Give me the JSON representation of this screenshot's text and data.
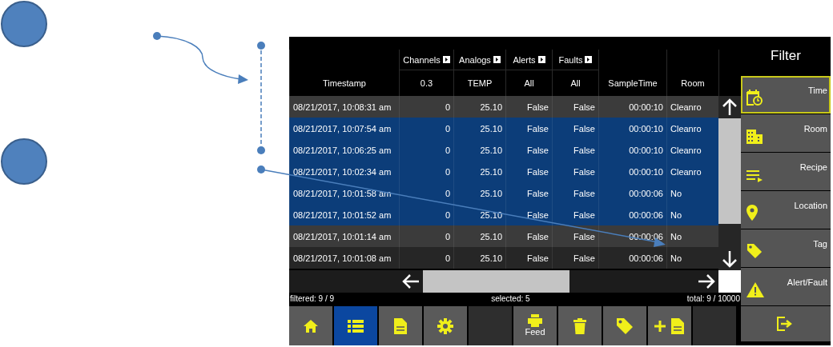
{
  "table": {
    "columns": [
      {
        "label": "Timestamp"
      },
      {
        "label": "Channels",
        "filter": "0.3"
      },
      {
        "label": "Analogs",
        "filter": "TEMP"
      },
      {
        "label": "Alerts",
        "filter": "All"
      },
      {
        "label": "Faults",
        "filter": "All"
      },
      {
        "label": "SampleTime"
      },
      {
        "label": "Room"
      }
    ],
    "rows": [
      {
        "selected": false,
        "cells": [
          "08/21/2017, 10:08:31 am",
          "0",
          "25.10",
          "False",
          "False",
          "00:00:10",
          "Cleanro"
        ]
      },
      {
        "selected": true,
        "cells": [
          "08/21/2017, 10:07:54 am",
          "0",
          "25.10",
          "False",
          "False",
          "00:00:10",
          "Cleanro"
        ]
      },
      {
        "selected": true,
        "cells": [
          "08/21/2017, 10:06:25 am",
          "0",
          "25.10",
          "False",
          "False",
          "00:00:10",
          "Cleanro"
        ]
      },
      {
        "selected": true,
        "cells": [
          "08/21/2017, 10:02:34 am",
          "0",
          "25.10",
          "False",
          "False",
          "00:00:10",
          "Cleanro"
        ]
      },
      {
        "selected": true,
        "cells": [
          "08/21/2017, 10:01:58 am",
          "0",
          "25.10",
          "False",
          "False",
          "00:00:06",
          "No"
        ]
      },
      {
        "selected": true,
        "cells": [
          "08/21/2017, 10:01:52 am",
          "0",
          "25.10",
          "False",
          "False",
          "00:00:06",
          "No"
        ]
      },
      {
        "selected": false,
        "cells": [
          "08/21/2017, 10:01:14 am",
          "0",
          "25.10",
          "False",
          "False",
          "00:00:06",
          "No"
        ]
      },
      {
        "selected": false,
        "cells": [
          "08/21/2017, 10:01:08 am",
          "0",
          "25.10",
          "False",
          "False",
          "00:00:06",
          "No"
        ]
      }
    ]
  },
  "status_bar": {
    "filtered": "filtered: 9 / 9",
    "selected": "selected: 5",
    "total": "total: 9 / 10000"
  },
  "toolbar": [
    {
      "kind": "home",
      "selected": false
    },
    {
      "kind": "list",
      "selected": true
    },
    {
      "kind": "document",
      "selected": false
    },
    {
      "kind": "settings",
      "selected": false
    },
    {
      "kind": "blank",
      "selected": false
    },
    {
      "kind": "print",
      "label": "Feed",
      "selected": false
    },
    {
      "kind": "delete",
      "selected": false
    },
    {
      "kind": "tag",
      "selected": false
    },
    {
      "kind": "add-document",
      "selected": false
    },
    {
      "kind": "blank",
      "selected": false
    }
  ],
  "filter": {
    "title": "Filter",
    "items": [
      {
        "kind": "time",
        "label": "Time",
        "selected": true
      },
      {
        "kind": "room",
        "label": "Room",
        "selected": false
      },
      {
        "kind": "recipe",
        "label": "Recipe",
        "selected": false
      },
      {
        "kind": "location",
        "label": "Location",
        "selected": false
      },
      {
        "kind": "tag",
        "label": "Tag",
        "selected": false
      },
      {
        "kind": "alert",
        "label": "Alert/Fault",
        "selected": false
      },
      {
        "kind": "exit",
        "selected": false
      }
    ]
  }
}
